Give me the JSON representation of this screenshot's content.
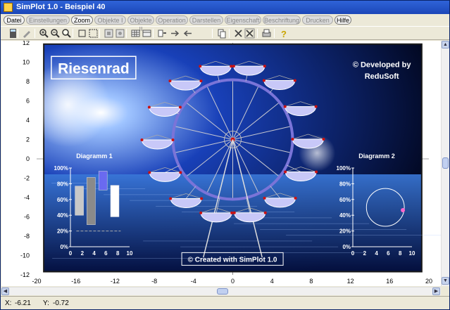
{
  "window": {
    "title": "SimPlot 1.0 - Beispiel 40"
  },
  "menu": [
    {
      "label": "Datei",
      "enabled": true
    },
    {
      "label": "Einstellungen",
      "enabled": false
    },
    {
      "label": "Zoom",
      "enabled": true
    },
    {
      "label": "Objekte I",
      "enabled": false
    },
    {
      "label": "Objekte II",
      "enabled": false
    },
    {
      "label": "Operation",
      "enabled": false
    },
    {
      "label": "Darstellen",
      "enabled": false
    },
    {
      "label": "Eigenschaft",
      "enabled": false
    },
    {
      "label": "Beschriftung",
      "enabled": false
    },
    {
      "label": "Drucken",
      "enabled": false
    },
    {
      "label": "Hilfe",
      "enabled": true
    }
  ],
  "toolbar": [
    "calculator-icon",
    "draw-icon",
    "zoom-in-icon",
    "zoom-out-icon",
    "zoom-fit-icon",
    "select-rect-icon",
    "select-area-icon",
    "layer-icon",
    "layer2-icon",
    "grid-icon",
    "table-icon",
    "move-icon",
    "arrow-right-icon",
    "arrow-left-icon",
    "copy-icon",
    "delete-icon",
    "delete-all-icon",
    "print-icon",
    "help-icon"
  ],
  "plot": {
    "title": "Riesenrad",
    "credit_line1": "© Developed by",
    "credit_line2": "ReduSoft",
    "footer": "© Created with SimPlot 1.0",
    "x_ticks": [
      "-20",
      "-16",
      "-12",
      "-8",
      "-4",
      "0",
      "4",
      "8",
      "12",
      "16",
      "20"
    ],
    "y_ticks": [
      "12",
      "10",
      "8",
      "6",
      "4",
      "2",
      "0",
      "-2",
      "-4",
      "-6",
      "-8",
      "-10",
      "-12"
    ],
    "colors": {
      "wheel": "#7a74d8",
      "gondola": "#c8c8f8",
      "spoke": "#c8c8d0",
      "hub": "#cc1111"
    }
  },
  "chart_data": [
    {
      "type": "bar",
      "title": "Diagramm 1",
      "categories": [
        "0",
        "2",
        "4",
        "6",
        "8",
        "10"
      ],
      "y_ticks": [
        "100%",
        "80%",
        "60%",
        "40%",
        "20%",
        "0%"
      ],
      "bars": [
        {
          "x": 1.5,
          "low": 40,
          "high": 77,
          "color": "#c8c8c8"
        },
        {
          "x": 3.5,
          "low": 28,
          "high": 88,
          "color": "#8a8a8a"
        },
        {
          "x": 5.5,
          "low": 72,
          "high": 96,
          "color": "#6a6af0"
        },
        {
          "x": 7.5,
          "low": 38,
          "high": 78,
          "color": "#ffffff"
        }
      ]
    },
    {
      "type": "line",
      "title": "Diagramm 2",
      "categories": [
        "0",
        "2",
        "4",
        "6",
        "8",
        "10"
      ],
      "y_ticks": [
        "100%",
        "80%",
        "60%",
        "40%",
        "20%",
        "0%"
      ],
      "circle": {
        "cx": 5.5,
        "cy": 50,
        "r_x": 3.2
      }
    }
  ],
  "status": {
    "x_label": "X:",
    "x_value": "-6.21",
    "y_label": "Y:",
    "y_value": "-0.72"
  }
}
